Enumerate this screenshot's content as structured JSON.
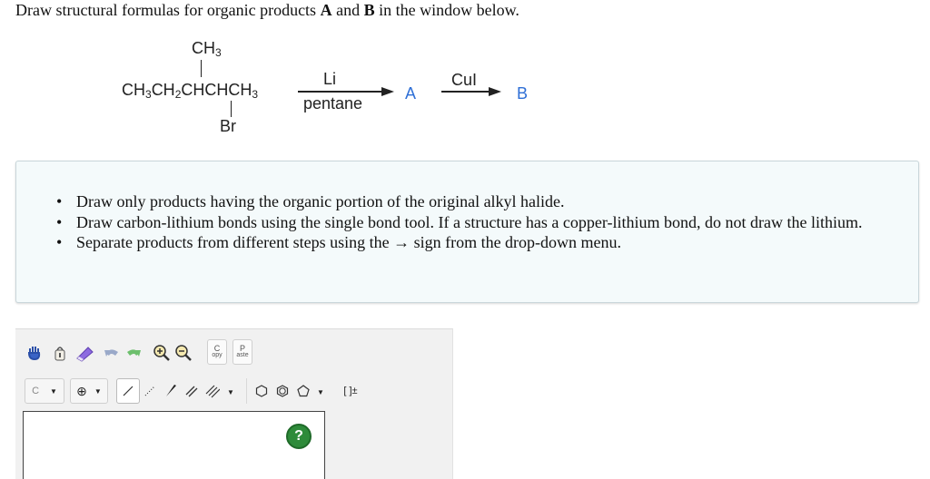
{
  "question": {
    "prefix": "Draw structural formulas for organic products ",
    "a": "A",
    "and": " and ",
    "b": "B",
    "suffix": " in the window below."
  },
  "reaction": {
    "methyl_top": "CH",
    "methyl_top_sub": "3",
    "chain_1": "CH",
    "chain_1_sub": "3",
    "chain_2": "CH",
    "chain_2_sub": "2",
    "chain_3": "CHCHCH",
    "chain_3_sub": "3",
    "bromo": "Br",
    "reagent1_top": "Li",
    "reagent1_bottom": "pentane",
    "product_a": "A",
    "reagent2_top": "CuI",
    "product_b": "B",
    "label_color": "#2f6fd6"
  },
  "instructions": [
    "Draw only products having the organic portion of the original alkyl halide.",
    "Draw carbon-lithium bonds using the single bond tool. If a structure has a copper-lithium bond, do not draw the lithium.",
    "Separate products from different steps using the → sign from the drop-down menu."
  ],
  "editor": {
    "toolbar_row1": [
      {
        "name": "hand-icon",
        "glyph": "✋"
      },
      {
        "name": "lasso-icon",
        "glyph": "❂"
      },
      {
        "name": "eraser-icon",
        "glyph": "▬"
      },
      {
        "name": "undo-icon",
        "glyph": "↶"
      },
      {
        "name": "redo-icon",
        "glyph": "↷"
      },
      {
        "name": "zoom-in-icon",
        "glyph": "⊕"
      },
      {
        "name": "zoom-out-icon",
        "glyph": "⊖"
      }
    ],
    "copy_top": "C",
    "copy_bottom": "opy",
    "paste_top": "P",
    "paste_bottom": "aste",
    "element_label": "C",
    "charge_glyph": "⊕",
    "bracket_label": "[ ]±",
    "help_label": "?"
  }
}
